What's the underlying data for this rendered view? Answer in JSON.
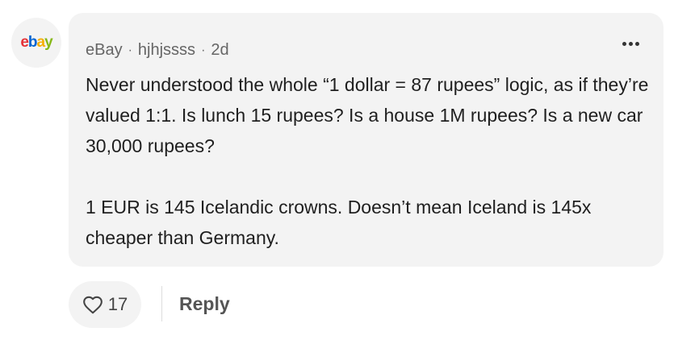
{
  "comment": {
    "avatar_logo": {
      "e": "e",
      "b": "b",
      "a": "a",
      "y": "y"
    },
    "author": "eBay",
    "username": "hjhjssss",
    "separator": "·",
    "time_ago": "2d",
    "more_icon": "more-horizontal-icon",
    "paragraphs": [
      "Never understood the whole “1 dollar = 87 rupees” logic, as if they’re valued 1:1. Is lunch 15 rupees? Is a house 1M rupees? Is a new car 30,000 rupees?",
      "1 EUR is 145 Icelandic crowns. Doesn’t mean Iceland is 145x cheaper than Germany."
    ]
  },
  "actions": {
    "like_icon": "heart-icon",
    "like_count": "17",
    "reply_label": "Reply"
  },
  "colors": {
    "bubble_bg": "#f3f3f3",
    "ebay_red": "#e53238",
    "ebay_blue": "#0064d2",
    "ebay_yellow": "#f5af02",
    "ebay_green": "#86b817"
  }
}
